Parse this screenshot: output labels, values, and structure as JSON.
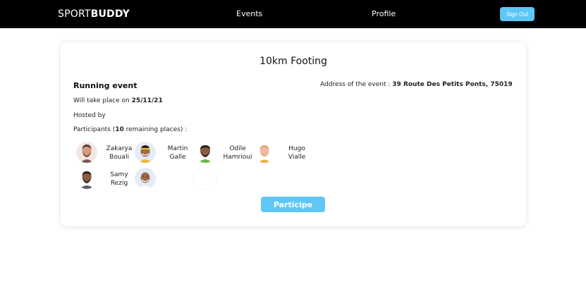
{
  "nav": {
    "brand_part1": "SPORT",
    "brand_part2": "BUDDY",
    "events_label": "Events",
    "profile_label": "Profile",
    "signout_label": "Sign Out"
  },
  "event": {
    "title": "10km Footing",
    "type": "Running event",
    "date_prefix": "Will take place on",
    "date": "25/11/21",
    "hosted_label": "Hosted by",
    "participants_prefix": "Participants (",
    "remaining_count": "10",
    "participants_suffix": " remaining places) :",
    "address_label": "Address of the event :",
    "address_value": "39 Route Des Petits Ponts, 75019",
    "participe_label": "Participe"
  },
  "participants": [
    {
      "first": "Zakarya",
      "last": "Bouali"
    },
    {
      "first": "Martin",
      "last": "Galle"
    },
    {
      "first": "Odile",
      "last": "Hamrioui"
    },
    {
      "first": "Hugo",
      "last": "Vialle"
    },
    {
      "first": "Samy",
      "last": "Rezig"
    },
    {
      "first": "",
      "last": ""
    }
  ],
  "colors": {
    "accent": "#5ec7f6",
    "header_bg": "#000000"
  }
}
